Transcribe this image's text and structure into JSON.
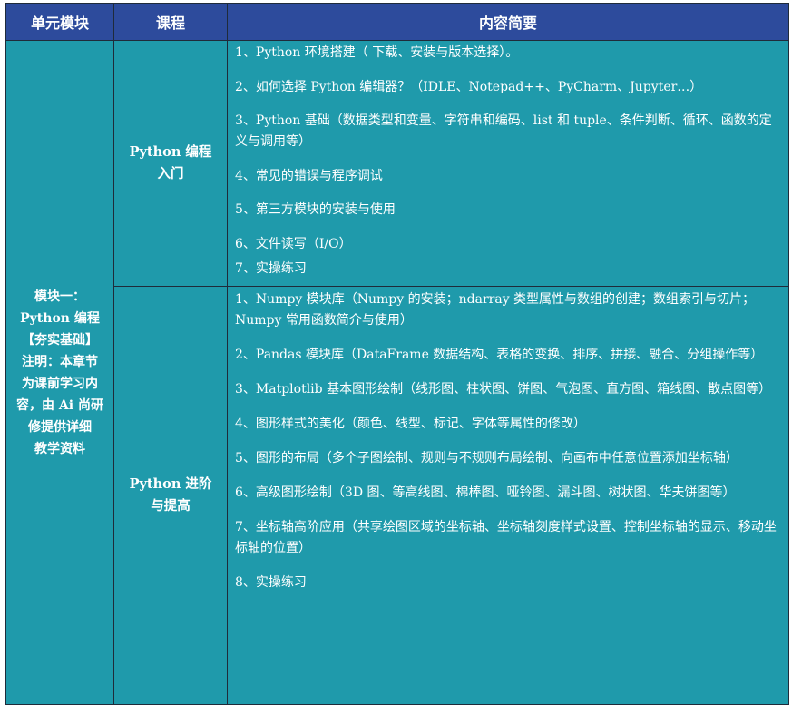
{
  "headers": [
    "单元模块",
    "课程",
    "内容简要"
  ],
  "module": {
    "lines": [
      "模块一：",
      "Python 编程",
      "【夯实基础】",
      "注明：本章节",
      "为课前学习内",
      "容，由 Ai 尚研",
      "修提供详细",
      "教学资料"
    ]
  },
  "courses": [
    {
      "title": "Python 编程入门",
      "items": [
        "1、Python 环境搭建（ 下载、安装与版本选择）。",
        "2、如何选择 Python 编辑器？（IDLE、Notepad++、PyCharm、Jupyter…）",
        "3、Python 基础（数据类型和变量、字符串和编码、list 和 tuple、条件判断、循环、函数的定义与调用等）",
        "4、常见的错误与程序调试",
        "5、第三方模块的安装与使用",
        "6、文件读写（I/O）",
        "7、实操练习"
      ]
    },
    {
      "title": "Python 进阶与提高",
      "items": [
        "1、Numpy 模块库（Numpy 的安装；ndarray 类型属性与数组的创建；数组索引与切片；Numpy 常用函数简介与使用）",
        "2、Pandas 模块库（DataFrame 数据结构、表格的变换、排序、拼接、融合、分组操作等）",
        "3、Matplotlib 基本图形绘制（线形图、柱状图、饼图、气泡图、直方图、箱线图、散点图等）",
        "4、图形样式的美化（颜色、线型、标记、字体等属性的修改）",
        "5、图形的布局（多个子图绘制、规则与不规则布局绘制、向画布中任意位置添加坐标轴）",
        "6、高级图形绘制（3D 图、等高线图、棉棒图、哑铃图、漏斗图、树状图、华夫饼图等）",
        "7、坐标轴高阶应用（共享绘图区域的坐标轴、坐标轴刻度样式设置、控制坐标轴的显示、移动坐标轴的位置）",
        "8、实操练习"
      ]
    }
  ]
}
